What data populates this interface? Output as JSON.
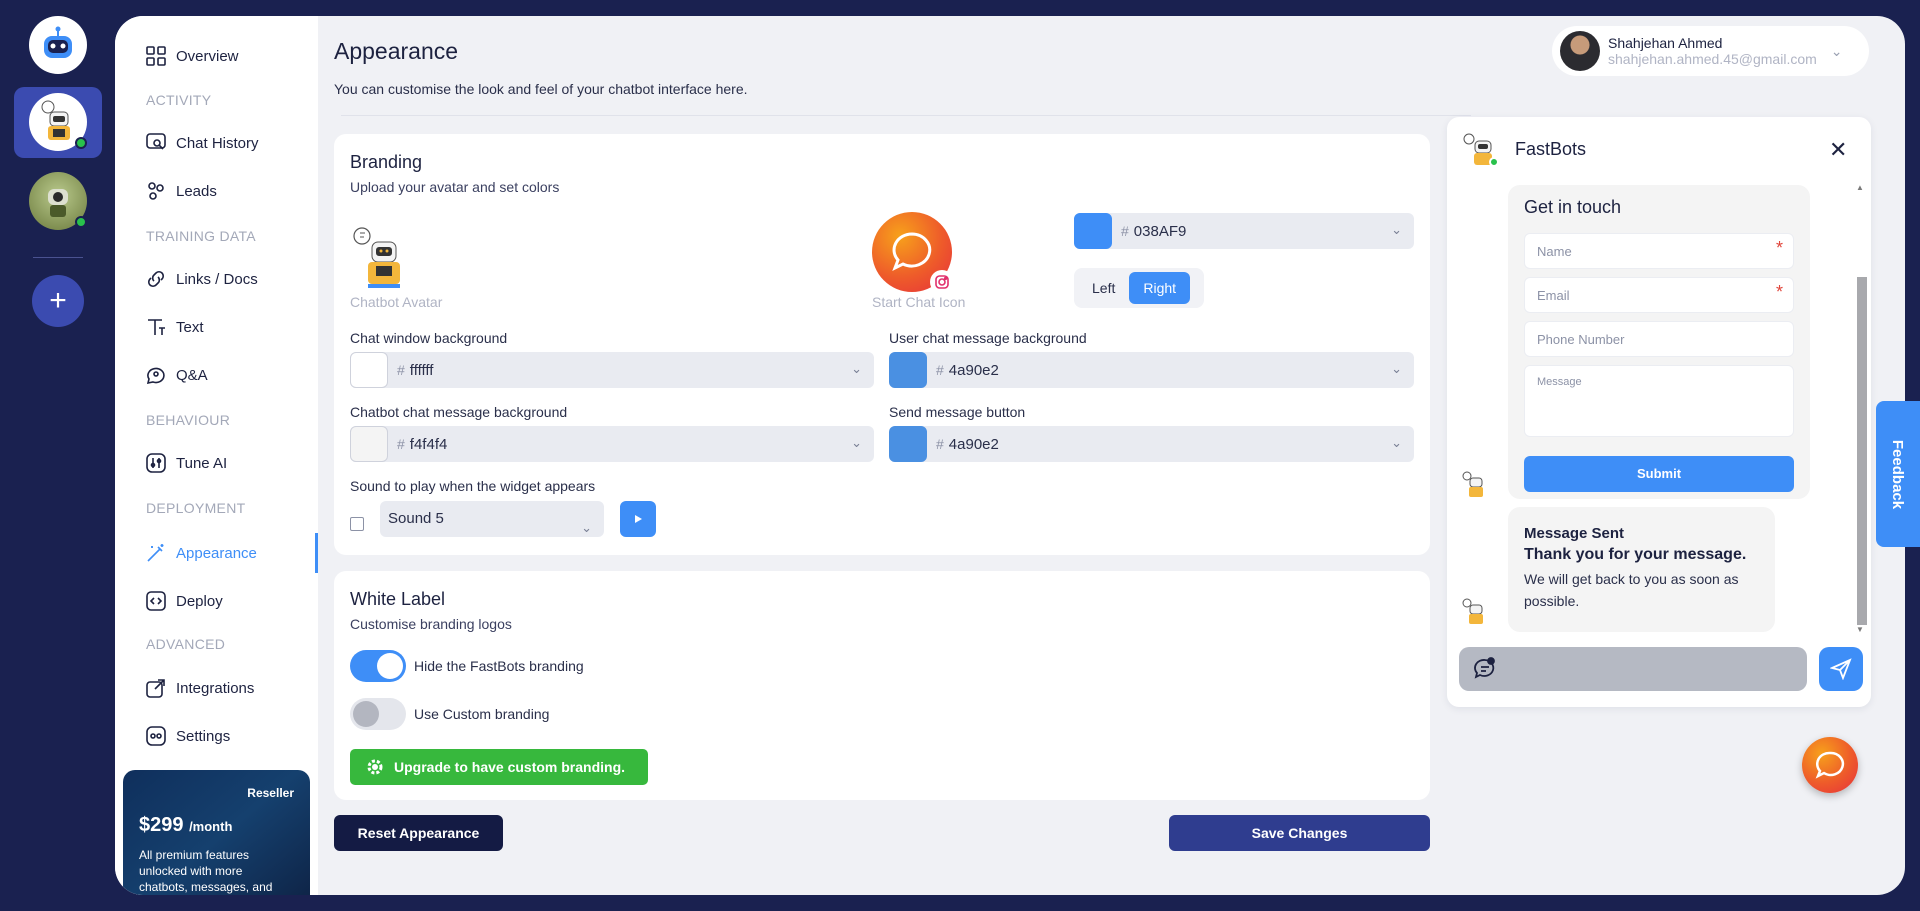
{
  "nav": {
    "overview": "Overview",
    "section_activity": "ACTIVITY",
    "chat_history": "Chat History",
    "leads": "Leads",
    "section_training": "TRAINING DATA",
    "links_docs": "Links / Docs",
    "text": "Text",
    "qa": "Q&A",
    "section_behaviour": "BEHAVIOUR",
    "tune_ai": "Tune AI",
    "section_deployment": "DEPLOYMENT",
    "appearance": "Appearance",
    "deploy": "Deploy",
    "section_advanced": "ADVANCED",
    "integrations": "Integrations",
    "settings": "Settings"
  },
  "promo": {
    "badge": "Reseller",
    "price": "$299",
    "period": "/month",
    "description": "All premium features unlocked with more chatbots, messages, and"
  },
  "header": {
    "title": "Appearance",
    "subtitle": "You can customise the look and feel of your chatbot interface here."
  },
  "user": {
    "name": "Shahjehan Ahmed",
    "email": "shahjehan.ahmed.45@gmail.com"
  },
  "branding": {
    "title": "Branding",
    "subtitle": "Upload your avatar and set colors",
    "avatar_caption": "Chatbot Avatar",
    "icon_caption": "Start Chat Icon",
    "accent_color": "038AF9",
    "accent_swatch": "#3e8ef7",
    "position_left": "Left",
    "position_right": "Right",
    "position_selected": "Right",
    "chat_window_bg_label": "Chat window background",
    "chat_window_bg": "ffffff",
    "user_msg_bg_label": "User chat message background",
    "user_msg_bg": "4a90e2",
    "bot_msg_bg_label": "Chatbot chat message background",
    "bot_msg_bg": "f4f4f4",
    "send_btn_label": "Send message button",
    "send_btn": "4a90e2",
    "sound_label": "Sound to play when the widget appears",
    "sound_enabled": false,
    "sound_value": "Sound 5"
  },
  "white_label": {
    "title": "White Label",
    "subtitle": "Customise branding logos",
    "hide_branding_label": "Hide the FastBots branding",
    "hide_branding": true,
    "custom_branding_label": "Use Custom branding",
    "custom_branding": false,
    "upgrade_label": "Upgrade to have custom branding."
  },
  "actions": {
    "reset": "Reset Appearance",
    "save": "Save Changes"
  },
  "widget": {
    "title": "FastBots",
    "form_title": "Get in touch",
    "name_placeholder": "Name",
    "email_placeholder": "Email",
    "phone_placeholder": "Phone Number",
    "message_placeholder": "Message",
    "submit": "Submit",
    "sent_title": "Message Sent",
    "sent_line2": "Thank you for your message.",
    "sent_line3": "We will get back to you as soon as possible."
  },
  "feedback": "Feedback",
  "icons": {
    "rail": [
      "robot-logo-icon",
      "plus-icon"
    ],
    "nav": [
      "grid-icon",
      "chat-search-icon",
      "users-icon",
      "link-icon",
      "text-icon",
      "qa-icon",
      "tune-icon",
      "magic-wand-icon",
      "code-icon",
      "integrations-icon",
      "settings-icon"
    ]
  },
  "colors": {
    "accent": "#3e8ef7",
    "navy": "#1a2150",
    "green": "#37b83d"
  }
}
